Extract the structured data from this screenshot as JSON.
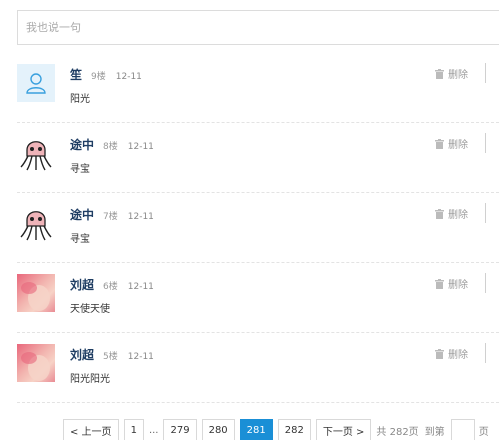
{
  "comment_box": {
    "placeholder": "我也说一句"
  },
  "comments": [
    {
      "name": "笙",
      "floor": "9楼",
      "date": "12-11",
      "content": "阳光",
      "avatar": "default-user-icon"
    },
    {
      "name": "途中",
      "floor": "8楼",
      "date": "12-11",
      "content": "寻宝",
      "avatar": "squid-avatar"
    },
    {
      "name": "途中",
      "floor": "7楼",
      "date": "12-11",
      "content": "寻宝",
      "avatar": "squid-avatar"
    },
    {
      "name": "刘超",
      "floor": "6楼",
      "date": "12-11",
      "content": "天使天使",
      "avatar": "photo-avatar"
    },
    {
      "name": "刘超",
      "floor": "5楼",
      "date": "12-11",
      "content": "阳光阳光",
      "avatar": "photo-avatar"
    }
  ],
  "delete_label": "删除",
  "pagination": {
    "prev": "< 上一页",
    "first": "1",
    "ellipsis": "...",
    "pages": [
      "279",
      "280",
      "281",
      "282"
    ],
    "current": "281",
    "next": "下一页 >",
    "total": "共 282页",
    "goto": "到第",
    "cut_text": "页"
  },
  "colors": {
    "accent": "#1a8fd6",
    "name": "#1f3d63",
    "avatar_bg": "#e4f2fb"
  }
}
